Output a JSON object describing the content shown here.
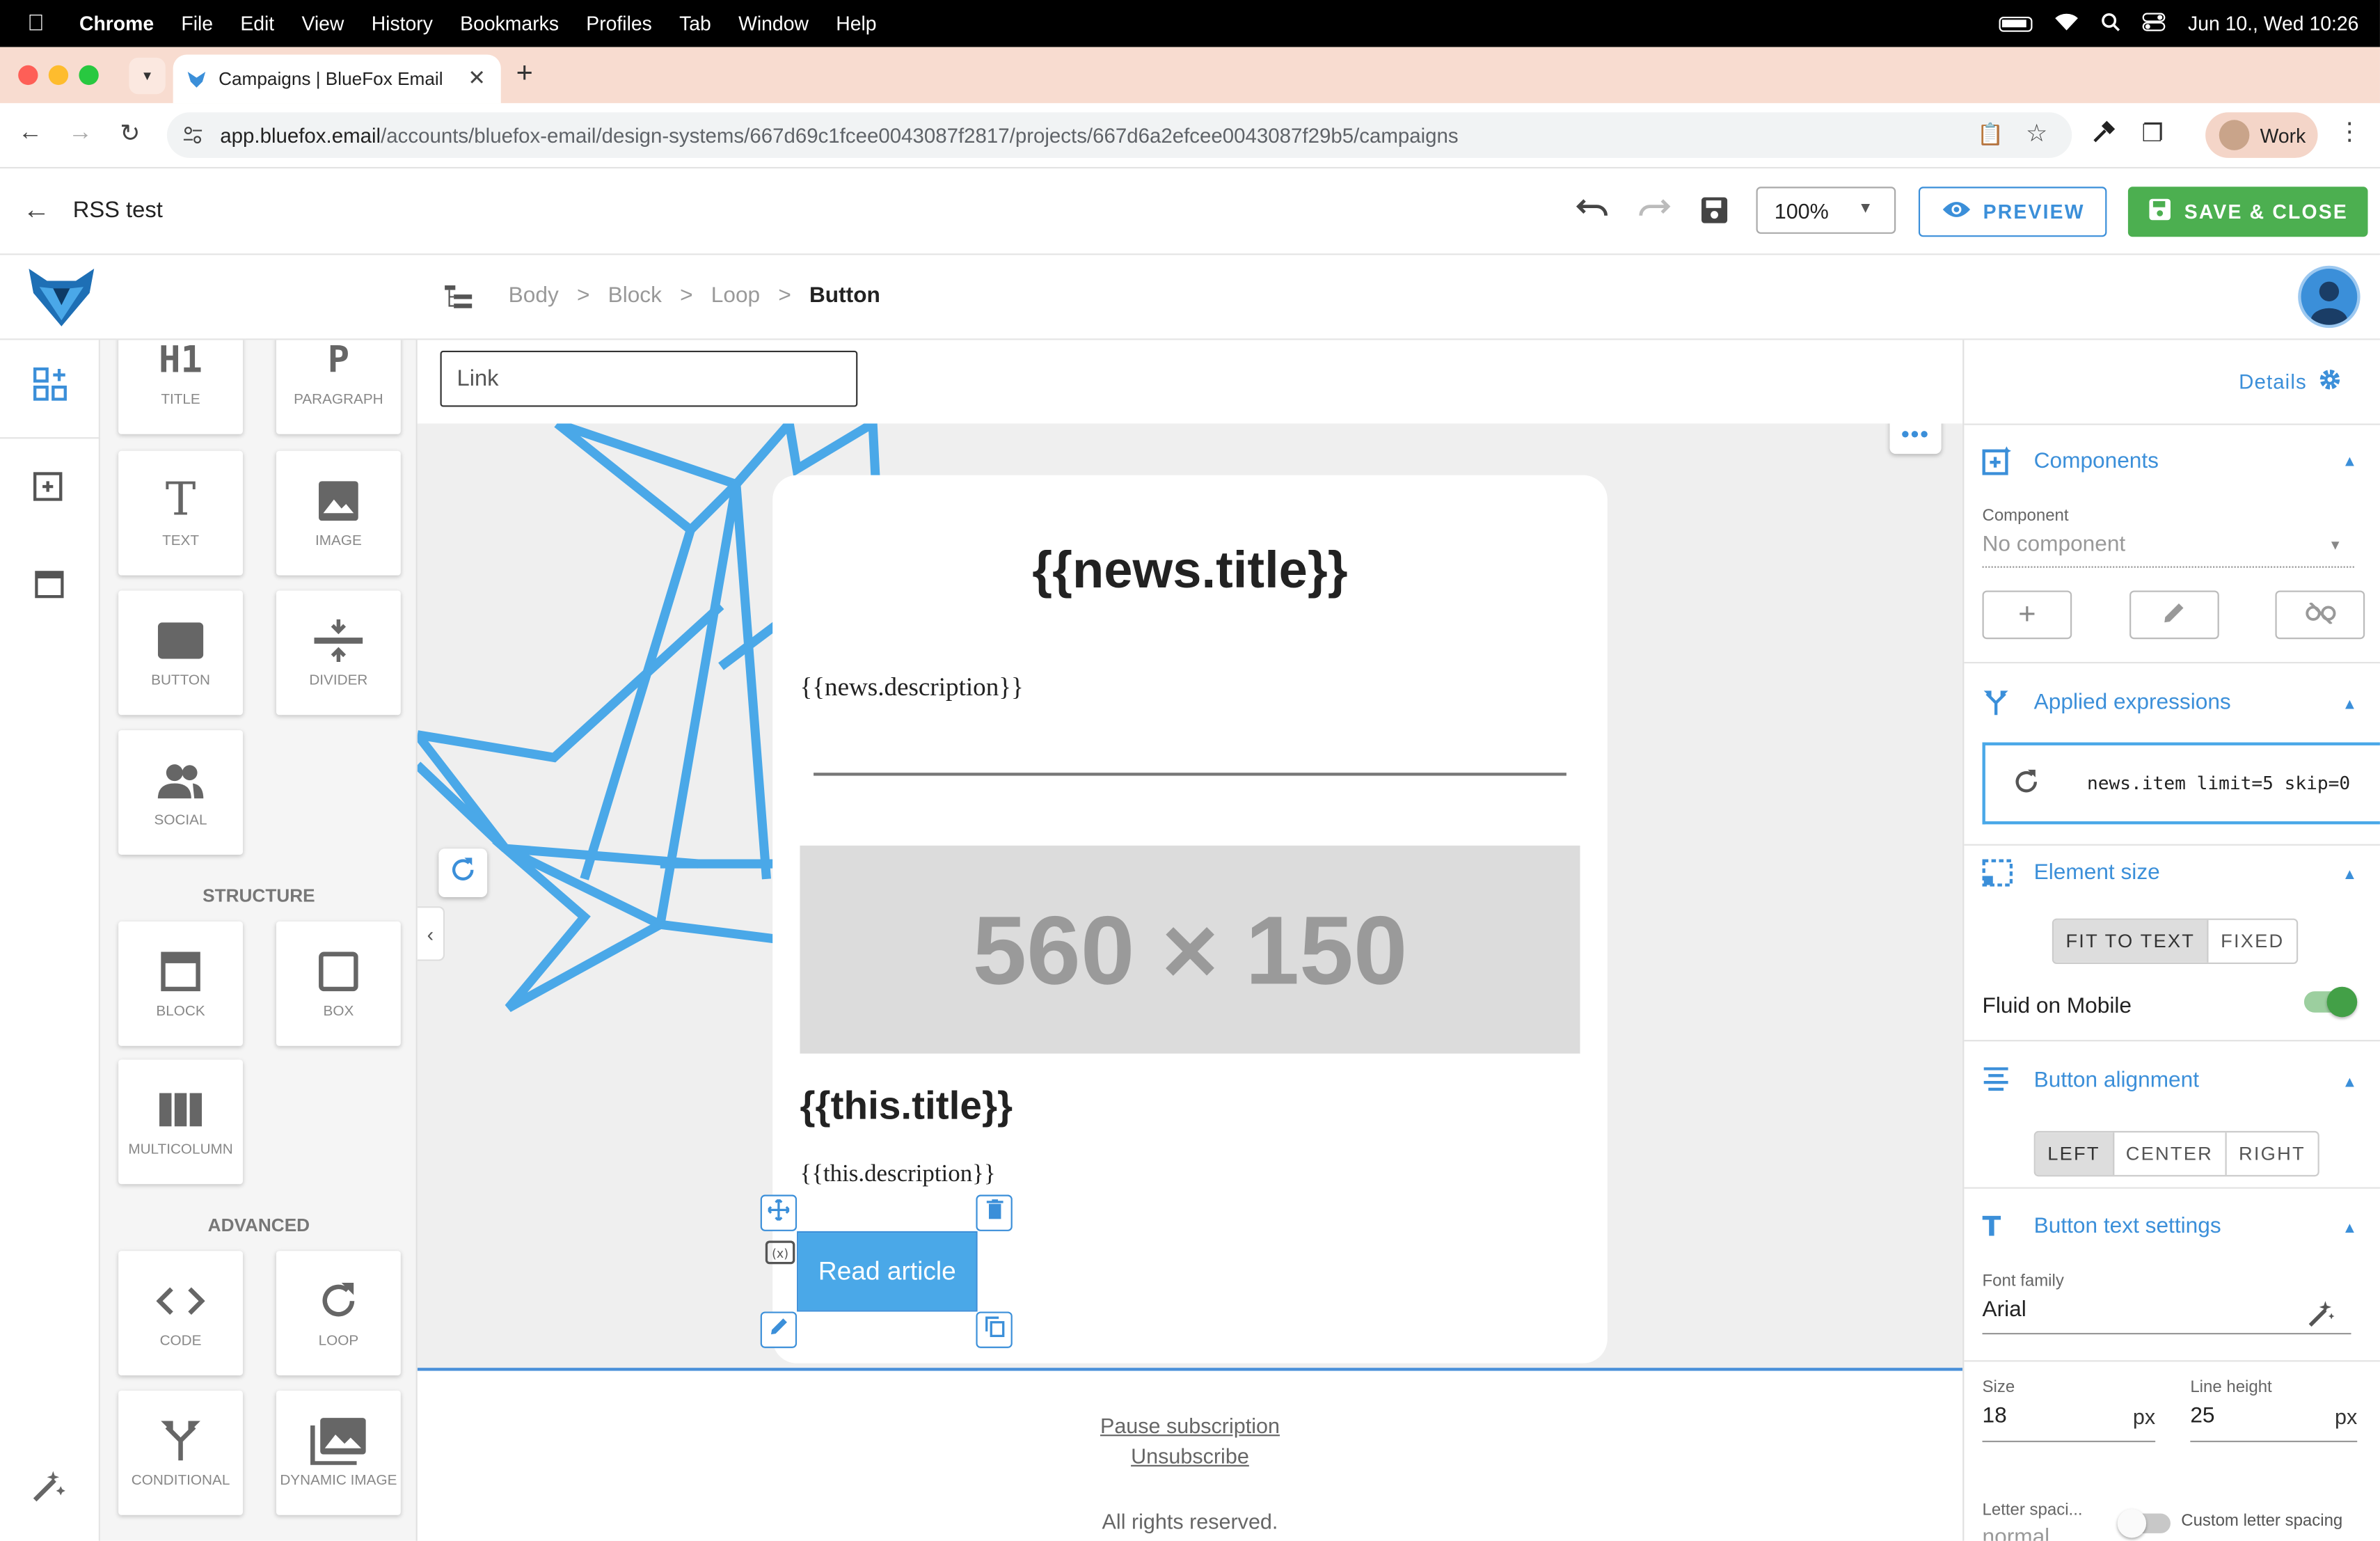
{
  "menubar": {
    "app": "Chrome",
    "items": [
      "File",
      "Edit",
      "View",
      "History",
      "Bookmarks",
      "Profiles",
      "Tab",
      "Window",
      "Help"
    ],
    "datetime": "Jun 10., Wed  10:26"
  },
  "browser": {
    "tab_title": "Campaigns | BlueFox Email",
    "url_host": "app.bluefox.email",
    "url_path": "/accounts/bluefox-email/design-systems/667d69c1fcee0043087f2817/projects/667d6a2efcee0043087f29b5/campaigns",
    "profile": "Work"
  },
  "header": {
    "title": "RSS test",
    "zoom": "100%",
    "preview_label": "PREVIEW",
    "save_label": "SAVE & CLOSE"
  },
  "breadcrumb": [
    "Body",
    "Block",
    "Loop",
    "Button"
  ],
  "components": {
    "basic": [
      {
        "icon": "H1",
        "label": "TITLE"
      },
      {
        "icon": "P",
        "label": "PARAGRAPH"
      },
      {
        "icon": "T",
        "label": "TEXT"
      },
      {
        "icon": "image-icon",
        "label": "IMAGE"
      },
      {
        "icon": "button-icon",
        "label": "BUTTON"
      },
      {
        "icon": "divider-icon",
        "label": "DIVIDER"
      },
      {
        "icon": "social-icon",
        "label": "SOCIAL"
      }
    ],
    "structure_title": "STRUCTURE",
    "structure": [
      {
        "icon": "block-icon",
        "label": "BLOCK"
      },
      {
        "icon": "box-icon",
        "label": "BOX"
      },
      {
        "icon": "multicolumn-icon",
        "label": "MULTICOLUMN"
      }
    ],
    "advanced_title": "ADVANCED",
    "advanced": [
      {
        "icon": "code-icon",
        "label": "CODE"
      },
      {
        "icon": "loop-icon",
        "label": "LOOP"
      },
      {
        "icon": "conditional-icon",
        "label": "CONDITIONAL"
      },
      {
        "icon": "dynamic-image-icon",
        "label": "DYNAMIC IMAGE"
      }
    ]
  },
  "canvas": {
    "link_placeholder": "Link",
    "news_title": "{{news.title}}",
    "news_description": "{{news.description}}",
    "image_placeholder": "560 × 150",
    "item_title": "{{this.title}}",
    "item_description": "{{this.description}}",
    "button_label": "Read article",
    "footer": {
      "pause": "Pause subscription",
      "unsubscribe": "Unsubscribe",
      "rights": "All rights reserved."
    }
  },
  "sidebar": {
    "details_label": "Details",
    "components_title": "Components",
    "component_label": "Component",
    "component_value": "No component",
    "expressions_title": "Applied expressions",
    "expression": "news.item limit=5 skip=0",
    "element_size_title": "Element size",
    "size_options": [
      "FIT TO TEXT",
      "FIXED"
    ],
    "size_selected": "FIT TO TEXT",
    "fluid_label": "Fluid on Mobile",
    "fluid_on": true,
    "alignment_title": "Button alignment",
    "alignment_options": [
      "LEFT",
      "CENTER",
      "RIGHT"
    ],
    "alignment_selected": "LEFT",
    "text_settings_title": "Button text settings",
    "font_family_label": "Font family",
    "font_family_value": "Arial",
    "size_label": "Size",
    "size_value": "18",
    "size_unit": "px",
    "line_height_label": "Line height",
    "line_height_value": "25",
    "line_height_unit": "px",
    "letter_spacing_label": "Letter spaci...",
    "letter_spacing_value": "normal",
    "custom_letter_spacing_label": "Custom letter spacing"
  },
  "colors": {
    "accent": "#3b8fd9",
    "save": "#4caf50",
    "button": "#4aa8e8",
    "toggle": "#43a047"
  }
}
